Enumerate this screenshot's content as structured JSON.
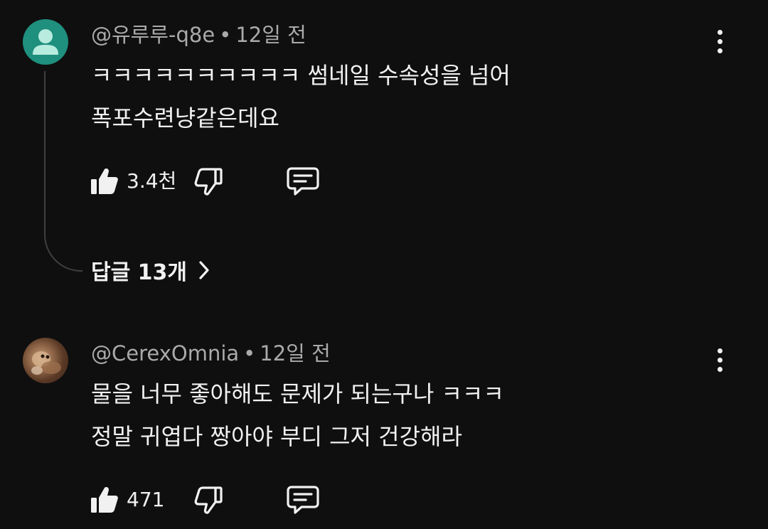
{
  "comments": [
    {
      "author": "@유루루-q8e",
      "separator": "•",
      "time": "12일 전",
      "lines": [
        "ㅋㅋㅋㅋㅋㅋㅋㅋㅋㅋ 썸네일 수속성을 넘어",
        "폭포수련냥같은데요"
      ],
      "like_count": "3.4천",
      "replies_label": "답글 13개",
      "avatar": "default-person-icon",
      "avatar_color": "#1f8f7e"
    },
    {
      "author": "@CerexOmnia",
      "separator": "•",
      "time": "12일 전",
      "lines": [
        "물을 너무 좋아해도 문제가 되는구나 ㅋㅋㅋ",
        "정말 귀엽다 짱아야 부디 그저 건강해라"
      ],
      "like_count": "471",
      "avatar": "photo-avatar"
    }
  ],
  "icons": {
    "like": "thumbs-up-icon",
    "dislike": "thumbs-down-icon",
    "reply": "comment-icon",
    "more": "more-vertical-icon",
    "expand": "chevron-right-icon"
  },
  "theme": {
    "background": "#0f0f0f",
    "text": "#f1f1f1",
    "secondary_text": "#aaaaaa"
  }
}
